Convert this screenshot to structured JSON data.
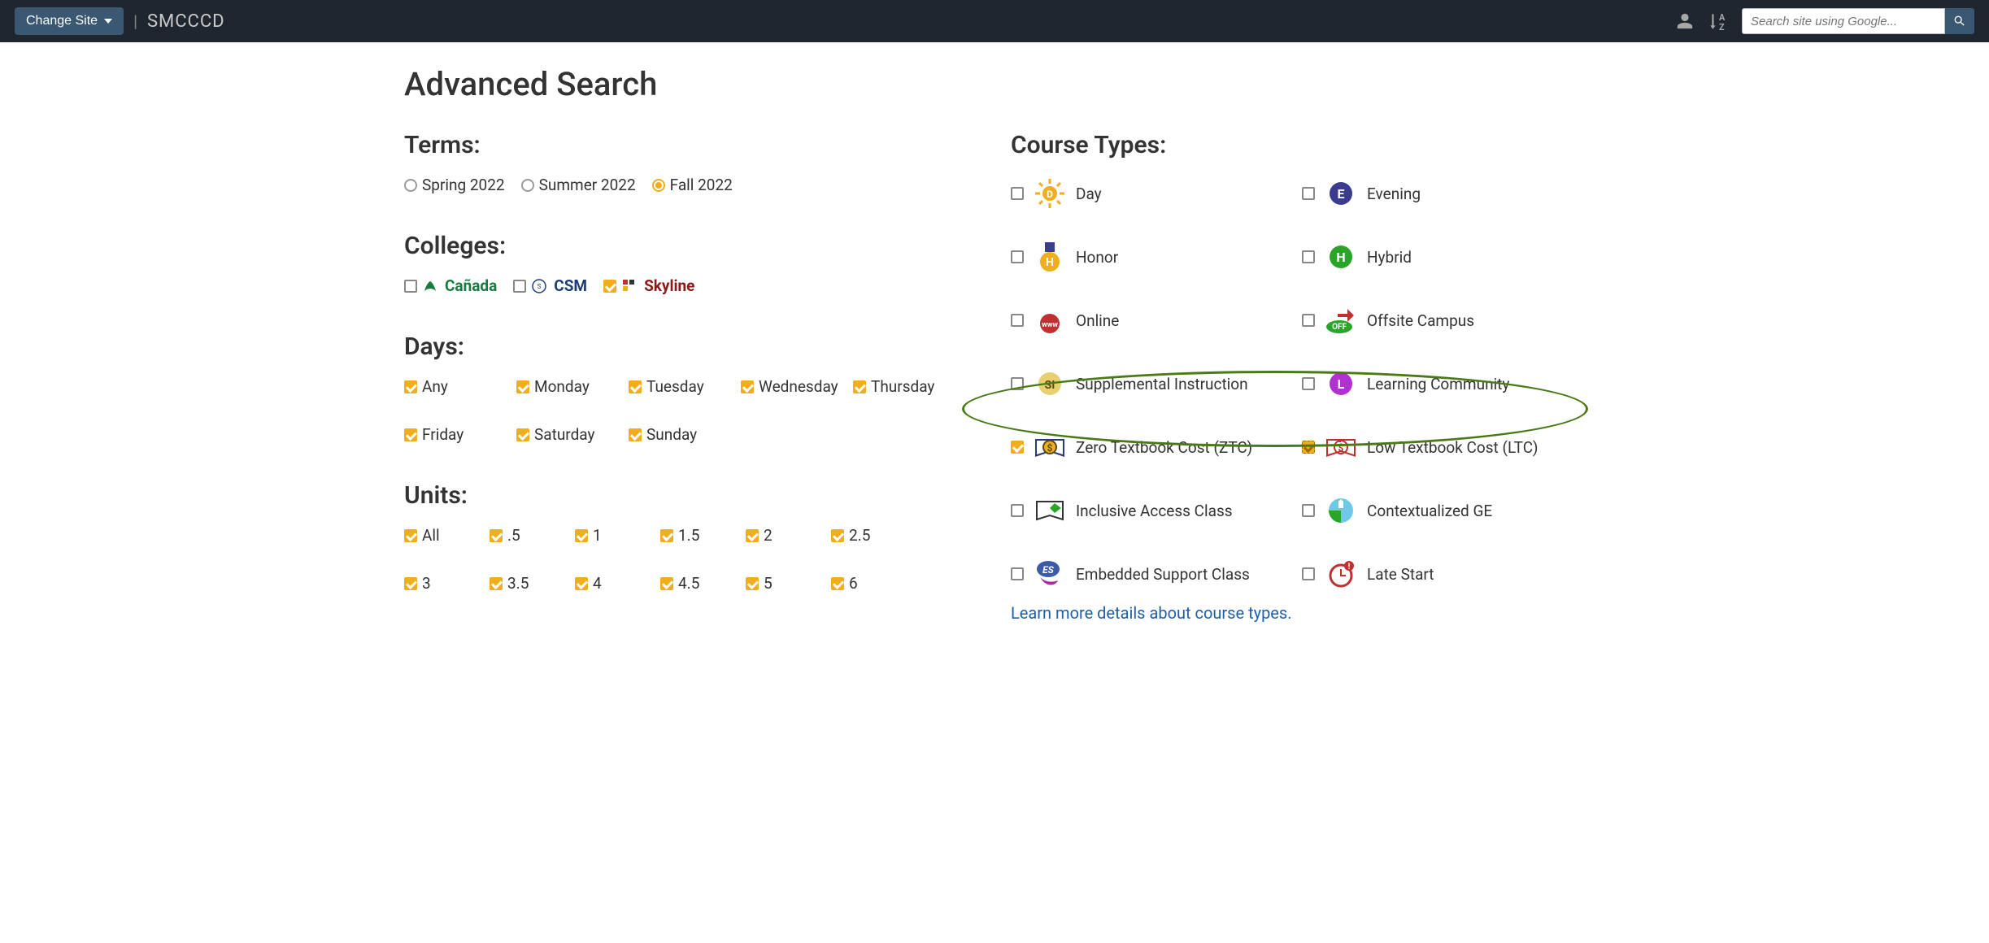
{
  "topbar": {
    "change_site": "Change Site",
    "site_name": "SMCCCD",
    "search_placeholder": "Search site using Google..."
  },
  "page_title": "Advanced Search",
  "sections": {
    "terms": {
      "heading": "Terms:",
      "options": [
        {
          "label": "Spring 2022",
          "selected": false
        },
        {
          "label": "Summer 2022",
          "selected": false
        },
        {
          "label": "Fall 2022",
          "selected": true
        }
      ]
    },
    "colleges": {
      "heading": "Colleges:",
      "options": [
        {
          "label": "Cañada",
          "checked": false,
          "class": "canada"
        },
        {
          "label": "CSM",
          "checked": false,
          "class": "csm"
        },
        {
          "label": "Skyline",
          "checked": true,
          "class": "skyline"
        }
      ]
    },
    "days": {
      "heading": "Days:",
      "options": [
        {
          "label": "Any",
          "checked": true
        },
        {
          "label": "Monday",
          "checked": true
        },
        {
          "label": "Tuesday",
          "checked": true
        },
        {
          "label": "Wednesday",
          "checked": true
        },
        {
          "label": "Thursday",
          "checked": true
        },
        {
          "label": "Friday",
          "checked": true
        },
        {
          "label": "Saturday",
          "checked": true
        },
        {
          "label": "Sunday",
          "checked": true
        }
      ]
    },
    "units": {
      "heading": "Units:",
      "options": [
        {
          "label": "All",
          "checked": true
        },
        {
          "label": ".5",
          "checked": true
        },
        {
          "label": "1",
          "checked": true
        },
        {
          "label": "1.5",
          "checked": true
        },
        {
          "label": "2",
          "checked": true
        },
        {
          "label": "2.5",
          "checked": true
        },
        {
          "label": "3",
          "checked": true
        },
        {
          "label": "3.5",
          "checked": true
        },
        {
          "label": "4",
          "checked": true
        },
        {
          "label": "4.5",
          "checked": true
        },
        {
          "label": "5",
          "checked": true
        },
        {
          "label": "6",
          "checked": true
        }
      ]
    },
    "course_types": {
      "heading": "Course Types:",
      "options": [
        {
          "label": "Day",
          "checked": false,
          "icon": "day"
        },
        {
          "label": "Evening",
          "checked": false,
          "icon": "evening"
        },
        {
          "label": "Honor",
          "checked": false,
          "icon": "honor"
        },
        {
          "label": "Hybrid",
          "checked": false,
          "icon": "hybrid"
        },
        {
          "label": "Online",
          "checked": false,
          "icon": "online"
        },
        {
          "label": "Offsite Campus",
          "checked": false,
          "icon": "offsite"
        },
        {
          "label": "Supplemental Instruction",
          "checked": false,
          "icon": "si"
        },
        {
          "label": "Learning Community",
          "checked": false,
          "icon": "learning"
        },
        {
          "label": "Zero Textbook Cost (ZTC)",
          "checked": true,
          "icon": "ztc"
        },
        {
          "label": "Low Textbook Cost (LTC)",
          "checked": "dashed",
          "icon": "ltc"
        },
        {
          "label": "Inclusive Access Class",
          "checked": false,
          "icon": "inclusive"
        },
        {
          "label": "Contextualized GE",
          "checked": false,
          "icon": "context"
        },
        {
          "label": "Embedded Support Class",
          "checked": false,
          "icon": "embedded"
        },
        {
          "label": "Late Start",
          "checked": false,
          "icon": "latestart"
        }
      ],
      "learn_more": "Learn more details about course types."
    }
  }
}
